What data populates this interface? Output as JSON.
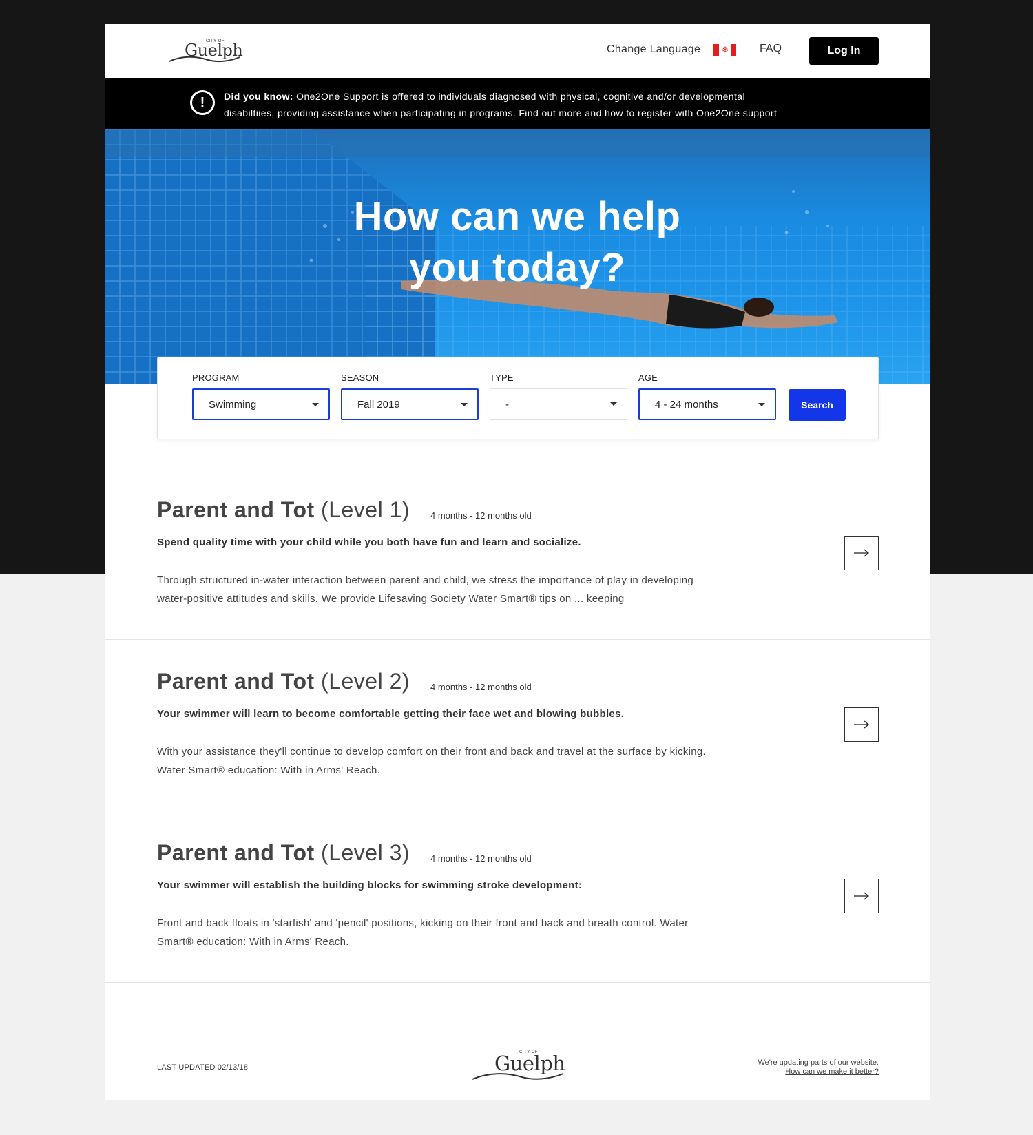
{
  "header": {
    "logo_small": "CITY OF",
    "logo_word": "Guelph",
    "change_language": "Change Language",
    "faq": "FAQ",
    "login": "Log In"
  },
  "banner": {
    "bold": "Did you know:",
    "line1": " One2One Support is offered to individuals diagnosed with physical, cognitive and/or developmental",
    "line2": "disabiltiies, providing assistance when participating in programs. Find out more and how to register with One2One support"
  },
  "hero": {
    "line1": "How can we help",
    "line2": "you today?"
  },
  "search": {
    "fields": [
      {
        "label": "PROGRAM",
        "value": "Swimming"
      },
      {
        "label": "SEASON",
        "value": "Fall 2019"
      },
      {
        "label": "TYPE",
        "value": "-"
      },
      {
        "label": "AGE",
        "value": "4 - 24 months"
      }
    ],
    "button": "Search"
  },
  "results": [
    {
      "title_bold": "Parent and Tot",
      "title_rest": " (Level 1)",
      "age": "4 months - 12 months old",
      "lead": "Spend quality time with your child while you both have fun and learn and socialize.",
      "desc": "Through structured in-water interaction between parent and child, we stress the importance of play in developing water-positive attitudes and skills. We provide Lifesaving Society Water Smart® tips on ... keeping"
    },
    {
      "title_bold": "Parent and Tot",
      "title_rest": " (Level 2)",
      "age": "4 months - 12 months old",
      "lead": "Your swimmer will learn to become comfortable getting their face wet and blowing bubbles.",
      "desc": "With your assistance they'll continue to develop comfort on their front and back and travel at the surface by kicking. Water Smart® education: With in Arms' Reach."
    },
    {
      "title_bold": "Parent and Tot",
      "title_rest": " (Level 3)",
      "age": "4 months - 12 months old",
      "lead": "Your swimmer will establish the building blocks for swimming stroke development:",
      "desc": "Front and back floats in 'starfish' and 'pencil' positions, kicking on their front and back and breath control. Water Smart® education: With in Arms' Reach."
    }
  ],
  "footer": {
    "last_updated": "LAST UPDATED 02/13/18",
    "logo_small": "CITY OF",
    "logo_word": "Guelph",
    "note": "We're updating parts of our website.",
    "link": "How can we make it better?"
  },
  "colors": {
    "primary": "#1337e8",
    "banner": "#000000",
    "hero": "#1a8be0"
  }
}
